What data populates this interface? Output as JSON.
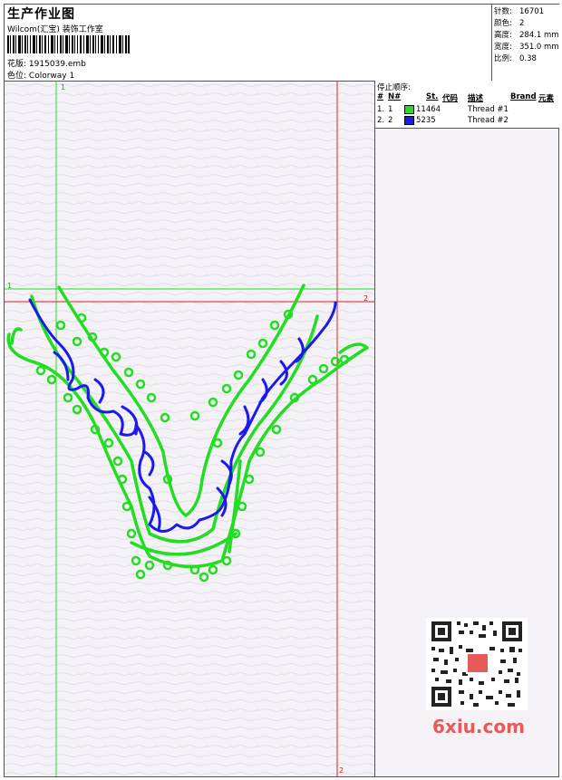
{
  "header": {
    "title": "生产作业图",
    "company": "Wilcom(汇宝) 装饰工作室",
    "design_label": "花版:",
    "design_value": "1915039.emb",
    "colorway_label": "色位:",
    "colorway_value": "Colorway 1"
  },
  "stats": [
    {
      "label": "针数:",
      "value": "16701"
    },
    {
      "label": "颜色:",
      "value": "2"
    },
    {
      "label": "高度:",
      "value": "284.1 mm"
    },
    {
      "label": "宽度:",
      "value": "351.0 mm"
    },
    {
      "label": "比例:",
      "value": "0.38"
    }
  ],
  "stop_sequence": {
    "title": "停止顺序:",
    "columns": [
      "#",
      "N#",
      "St.",
      "代码",
      "描述",
      "Brand",
      "元素"
    ],
    "rows": [
      {
        "idx": "1.",
        "n": "1",
        "color": "#22dd22",
        "code": "11464",
        "desc": "Thread #1"
      },
      {
        "idx": "2.",
        "n": "2",
        "color": "#1a1aee",
        "code": "5235",
        "desc": "Thread #2"
      }
    ]
  },
  "guides": {
    "green_v_label": "1",
    "green_h_label": "1",
    "red_h_label": "2",
    "red_v_label": "2",
    "green_color": "#22dd22",
    "red_color": "#dd2222"
  },
  "watermark": {
    "site": "6xiu.com",
    "stamp": "以图找图"
  }
}
